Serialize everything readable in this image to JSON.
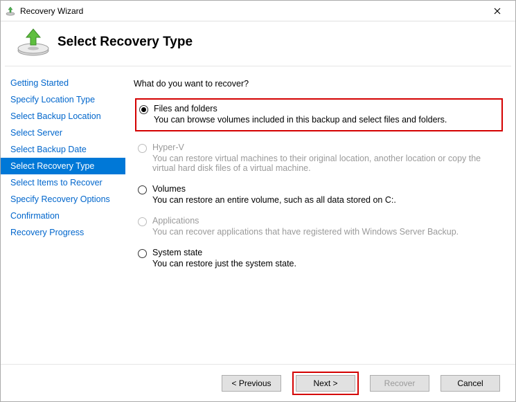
{
  "window": {
    "title": "Recovery Wizard"
  },
  "header": {
    "title": "Select Recovery Type"
  },
  "sidebar": {
    "steps": [
      {
        "label": "Getting Started"
      },
      {
        "label": "Specify Location Type"
      },
      {
        "label": "Select Backup Location"
      },
      {
        "label": "Select Server"
      },
      {
        "label": "Select Backup Date"
      },
      {
        "label": "Select Recovery Type"
      },
      {
        "label": "Select Items to Recover"
      },
      {
        "label": "Specify Recovery Options"
      },
      {
        "label": "Confirmation"
      },
      {
        "label": "Recovery Progress"
      }
    ]
  },
  "content": {
    "prompt": "What do you want to recover?",
    "options": {
      "files": {
        "title": "Files and folders",
        "desc": "You can browse volumes included in this backup and select files and folders."
      },
      "hyperv": {
        "title": "Hyper-V",
        "desc": "You can restore virtual machines to their original location, another location or copy the virtual hard disk files of a virtual machine."
      },
      "volumes": {
        "title": "Volumes",
        "desc": "You can restore an entire volume, such as all data stored on C:."
      },
      "applications": {
        "title": "Applications",
        "desc": "You can recover applications that have registered with Windows Server Backup."
      },
      "system": {
        "title": "System state",
        "desc": "You can restore just the system state."
      }
    }
  },
  "footer": {
    "previous": "< Previous",
    "next": "Next >",
    "recover": "Recover",
    "cancel": "Cancel"
  }
}
